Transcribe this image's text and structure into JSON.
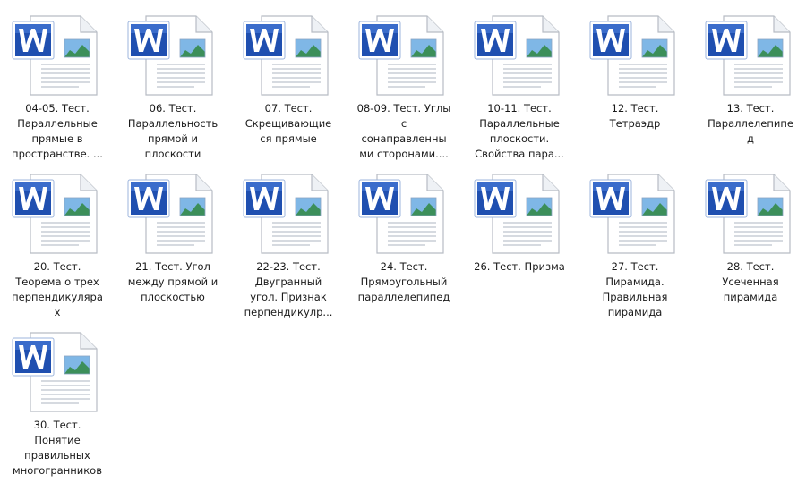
{
  "icon": "word-document-icon",
  "colors": {
    "word_blue": "#1f4fb0",
    "word_blue_dark": "#173d8c",
    "sky": "#7fb7e6",
    "hill": "#3c8f5a",
    "paper": "#ffffff",
    "paper_edge": "#b7bcc4",
    "label_text": "#1a1a1a"
  },
  "files": [
    {
      "label_lines": [
        "04-05. Тест.",
        "Параллельные",
        "прямые в",
        "пространстве. ..."
      ]
    },
    {
      "label_lines": [
        "06. Тест.",
        "Параллельность",
        "прямой и",
        "плоскости"
      ]
    },
    {
      "label_lines": [
        "07. Тест.",
        "Скрещивающие",
        "ся прямые"
      ]
    },
    {
      "label_lines": [
        "08-09. Тест. Углы",
        "с",
        "сонаправленны",
        "ми сторонами...."
      ]
    },
    {
      "label_lines": [
        "10-11. Тест.",
        "Параллельные",
        "плоскости.",
        "Свойства пара..."
      ]
    },
    {
      "label_lines": [
        "12. Тест.",
        "Тетраэдр"
      ]
    },
    {
      "label_lines": [
        "13. Тест.",
        "Параллелепипе",
        "д"
      ]
    },
    {
      "label_lines": [
        "20. Тест.",
        "Теорема о трех",
        "перпендикуляра",
        "х"
      ]
    },
    {
      "label_lines": [
        "21. Тест. Угол",
        "между прямой и",
        "плоскостью"
      ]
    },
    {
      "label_lines": [
        "22-23. Тест.",
        "Двугранный",
        "угол. Признак",
        "перпендикулр..."
      ]
    },
    {
      "label_lines": [
        "24. Тест.",
        "Прямоугольный",
        "параллелепипед"
      ]
    },
    {
      "label_lines": [
        "26. Тест. Призма"
      ]
    },
    {
      "label_lines": [
        "27. Тест.",
        "Пирамида.",
        "Правильная",
        "пирамида"
      ]
    },
    {
      "label_lines": [
        "28. Тест.",
        "Усеченная",
        "пирамида"
      ]
    },
    {
      "label_lines": [
        "30. Тест.",
        "Понятие",
        "правильных",
        "многогранников"
      ]
    }
  ]
}
